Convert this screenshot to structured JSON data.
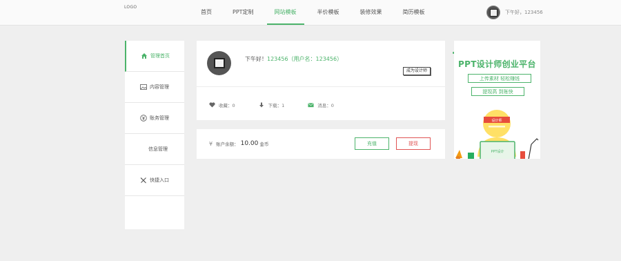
{
  "header": {
    "logo": "LOGO",
    "nav": [
      {
        "label": "首页",
        "active": false
      },
      {
        "label": "PPT定制",
        "active": false
      },
      {
        "label": "网站模板",
        "active": true
      },
      {
        "label": "半价模板",
        "active": false
      },
      {
        "label": "装修效果",
        "active": false
      },
      {
        "label": "简历模板",
        "active": false
      }
    ],
    "user_greeting": "下午好，123456"
  },
  "sidebar": {
    "items": [
      {
        "label": "管理首页",
        "icon": "home-icon",
        "active": true
      },
      {
        "label": "内容管理",
        "icon": "picture-icon",
        "active": false
      },
      {
        "label": "账务管理",
        "icon": "yen-icon",
        "active": false
      },
      {
        "label": "信息管理",
        "icon": "",
        "active": false
      },
      {
        "label": "快捷入口",
        "icon": "pencil-ruler-icon",
        "active": false
      }
    ]
  },
  "profile": {
    "greeting_prefix": "下午好！",
    "greeting_user": "123456（用户名：123456）",
    "badge_button": "成为设计师",
    "stats": [
      {
        "label": "收藏：0",
        "icon": "heart-icon"
      },
      {
        "label": "下载：1",
        "icon": "download-arrow-icon"
      },
      {
        "label": "消息：0",
        "icon": "mail-icon"
      }
    ]
  },
  "balance": {
    "symbol": "¥",
    "label": "账户余额：",
    "amount": "10.00",
    "unit": "金币",
    "recharge_button": "充值",
    "withdraw_button": "提现"
  },
  "ad": {
    "title": "PPT设计师创业平台",
    "line1": "上传素材  轻松赚钱",
    "line2": "提现高  到账快",
    "headband_text": "设计师",
    "laptop_text": "PPT设计"
  },
  "colors": {
    "accent": "#4bb36a",
    "danger": "#e05353",
    "background": "#efefef"
  }
}
